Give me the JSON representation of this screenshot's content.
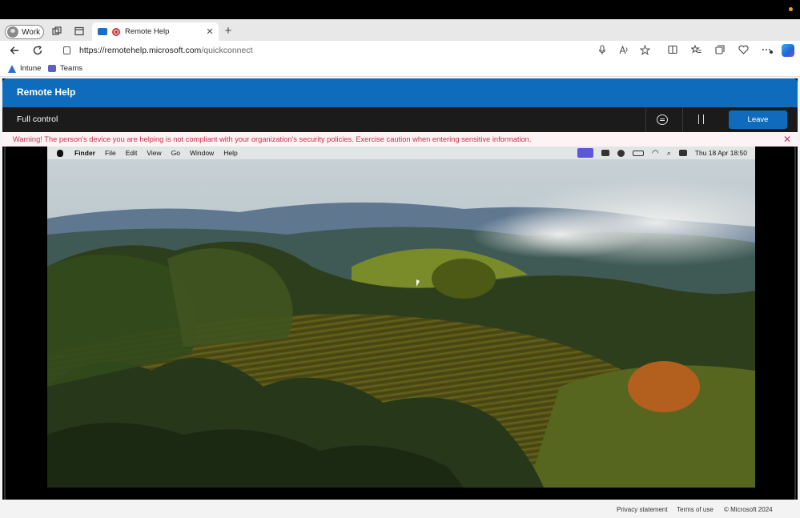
{
  "browser": {
    "profile_label": "Work",
    "tab": {
      "title": "Remote Help"
    },
    "address": {
      "origin": "https://remotehelp.microsoft.com",
      "path": "/quickconnect"
    },
    "favorites": [
      {
        "label": "Intune",
        "icon": "intune-icon"
      },
      {
        "label": "Teams",
        "icon": "teams-icon"
      }
    ]
  },
  "app": {
    "title": "Remote Help",
    "session": {
      "mode_label": "Full control",
      "leave_label": "Leave"
    },
    "warning": {
      "text": "Warning! The person's device you are helping is not compliant with your organization's security policies. Exercise caution when entering sensitive information."
    }
  },
  "remote_desktop": {
    "menubar": {
      "app_name": "Finder",
      "items": [
        "File",
        "Edit",
        "View",
        "Go",
        "Window",
        "Help"
      ],
      "clock": "Thu 18 Apr  18:50"
    }
  },
  "footer": {
    "links": [
      "Privacy statement",
      "Terms of use",
      "© Microsoft 2024"
    ]
  }
}
